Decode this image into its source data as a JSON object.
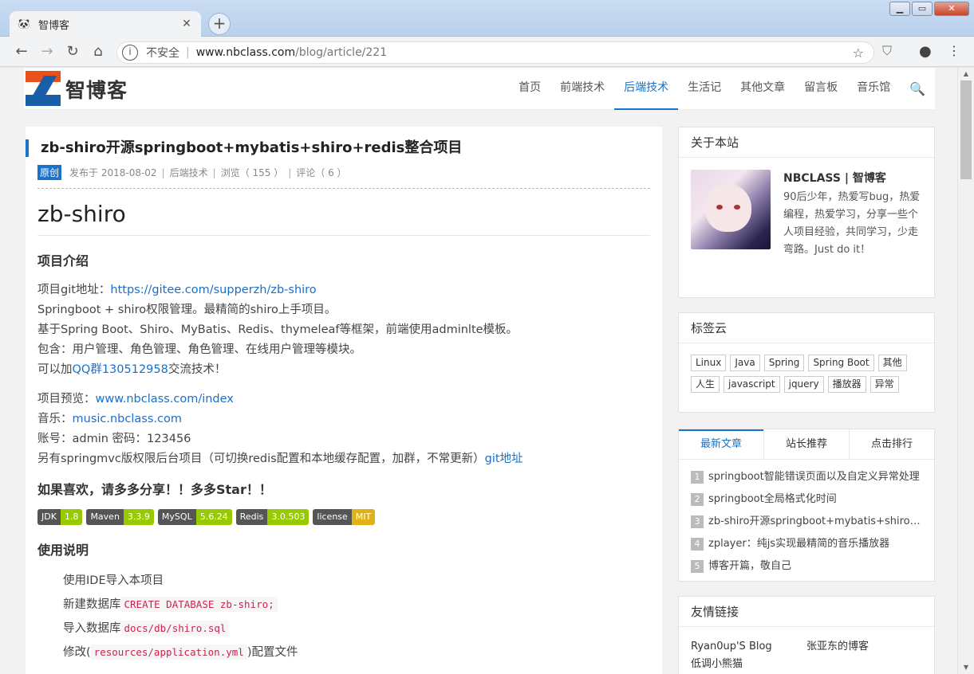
{
  "browser": {
    "tab_title": "智博客",
    "tab_favicon": "panda-icon",
    "security_label": "不安全",
    "url_host": "www.nbclass.com",
    "url_path": "/blog/article/221"
  },
  "site": {
    "logo_text": "智博客",
    "nav": [
      "首页",
      "前端技术",
      "后端技术",
      "生活记",
      "其他文章",
      "留言板",
      "音乐馆"
    ],
    "active_nav": "后端技术",
    "accent": "#1a73c9"
  },
  "article": {
    "title": "zb-shiro开源springboot+mybatis+shiro+redis整合项目",
    "badge": "原创",
    "published": "发布于 2018-08-02",
    "category": "后端技术",
    "views": "浏览（ 155 ）",
    "comments": "评论（ 6 ）",
    "h1": "zb-shiro",
    "intro_heading": "项目介绍",
    "git_label": "项目git地址：",
    "git_link": "https://gitee.com/supperzh/zb-shiro",
    "line1": "Springboot + shiro权限管理。最精简的shiro上手项目。",
    "line2": "基于Spring Boot、Shiro、MyBatis、Redis、thymeleaf等框架，前端使用adminlte模板。",
    "line3": "包含：用户管理、角色管理、角色管理、在线用户管理等模块。",
    "line4_pre": "可以加",
    "line4_link": "QQ群130512958",
    "line4_post": "交流技术！",
    "preview_label": "项目预览：",
    "preview_link": "www.nbclass.com/index",
    "music_label": "音乐：",
    "music_link": "music.nbclass.com",
    "account": "账号：admin 密码：123456",
    "extra_pre": "另有springmvc版权限后台项目（可切换redis配置和本地缓存配置，加群，不常更新）",
    "extra_link": "git地址",
    "like_heading": "如果喜欢，请多多分享！！多多Star！！",
    "badges": [
      {
        "label": "JDK",
        "value": "1.8",
        "color": "#97ca00"
      },
      {
        "label": "Maven",
        "value": "3.3.9",
        "color": "#97ca00"
      },
      {
        "label": "MySQL",
        "value": "5.6.24",
        "color": "#97ca00"
      },
      {
        "label": "Redis",
        "value": "3.0.503",
        "color": "#97ca00"
      },
      {
        "label": "license",
        "value": "MIT",
        "color": "#dfb317"
      }
    ],
    "usage_heading": "使用说明",
    "step1": "使用IDE导入本项目",
    "step2_pre": "新建数据库",
    "step2_code": "CREATE DATABASE zb-shiro;",
    "step3_pre": "导入数据库",
    "step3_code": "docs/db/shiro.sql",
    "step4_pre": "修改(",
    "step4_code": "resources/application.yml",
    "step4_post": ")配置文件"
  },
  "sidebar": {
    "about": {
      "heading": "关于本站",
      "name": "NBCLASS | 智博客",
      "desc": "90后少年，热爱写bug，热爱编程，热爱学习，分享一些个人项目经验，共同学习，少走弯路。Just do it！"
    },
    "tags": {
      "heading": "标签云",
      "items": [
        "Linux",
        "Java",
        "Spring",
        "Spring Boot",
        "其他",
        "人生",
        "javascript",
        "jquery",
        "播放器",
        "异常"
      ]
    },
    "posts": {
      "tabs": [
        "最新文章",
        "站长推荐",
        "点击排行"
      ],
      "items": [
        "springboot智能错误页面以及自定义异常处理",
        "springboot全局格式化时间",
        "zb-shiro开源springboot+mybatis+shiro+redis整合项目",
        "zplayer：纯js实现最精简的音乐播放器",
        "博客开篇，敬自己"
      ]
    },
    "links": {
      "heading": "友情链接",
      "items": [
        "Ryan0up'S Blog",
        "张亚东的博客",
        "低调小熊猫"
      ]
    }
  }
}
